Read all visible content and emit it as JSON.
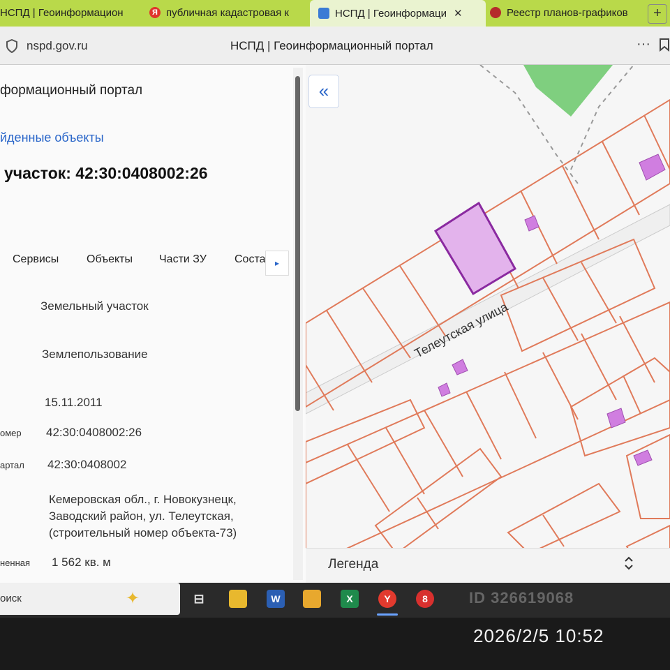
{
  "browser": {
    "tabs": [
      {
        "label": "НСПД | Геоинформацион",
        "icon": "nspd-icon",
        "active": false
      },
      {
        "label": "публичная кадастровая к",
        "icon": "yandex-icon",
        "active": false
      },
      {
        "label": "НСПД | Геоинформаци",
        "icon": "nspd-icon",
        "active": true,
        "close": "✕"
      },
      {
        "label": "Реестр планов-графиков",
        "icon": "emblem-icon",
        "active": false
      }
    ],
    "new_tab": "+",
    "domain": "nspd.gov.ru",
    "page_title": "НСПД | Геоинформационный портал",
    "more": "···"
  },
  "panel": {
    "portal_title": "формационный портал",
    "found_link": "йденные объекты",
    "parcel_title": "участок: 42:30:0408002:26",
    "tabs": [
      "Сервисы",
      "Объекты",
      "Части ЗУ",
      "Соста"
    ],
    "tabs_arrow": "▸",
    "fields": [
      {
        "label": "",
        "value": "Земельный участок"
      },
      {
        "label": "",
        "value": "Землепользование"
      },
      {
        "label": "",
        "value": "15.11.2011"
      },
      {
        "label": "омер",
        "value": "42:30:0408002:26"
      },
      {
        "label": "артал",
        "value": "42:30:0408002"
      },
      {
        "label": "",
        "value": [
          "Кемеровская обл., г. Новокузнецк,",
          "Заводский район, ул. Телеутская,",
          "(строительный номер объекта-73)"
        ]
      },
      {
        "label": "ненная",
        "value": "1 562 кв. м"
      }
    ]
  },
  "map": {
    "collapse": "«",
    "street_label": "Телеутская улица",
    "legend": "Легенда",
    "legend_toggle": "⌃⌄",
    "colors": {
      "parcel_line": "#e07a5a",
      "selected_fill": "#e3b3ec",
      "selected_stroke": "#8a2aa0",
      "building": "#d07ee0",
      "green_zone": "#7fcf7f"
    }
  },
  "taskbar": {
    "search": "оиск",
    "watermark": "ID 326619068"
  },
  "photo_timestamp": "2026/2/5 10:52"
}
